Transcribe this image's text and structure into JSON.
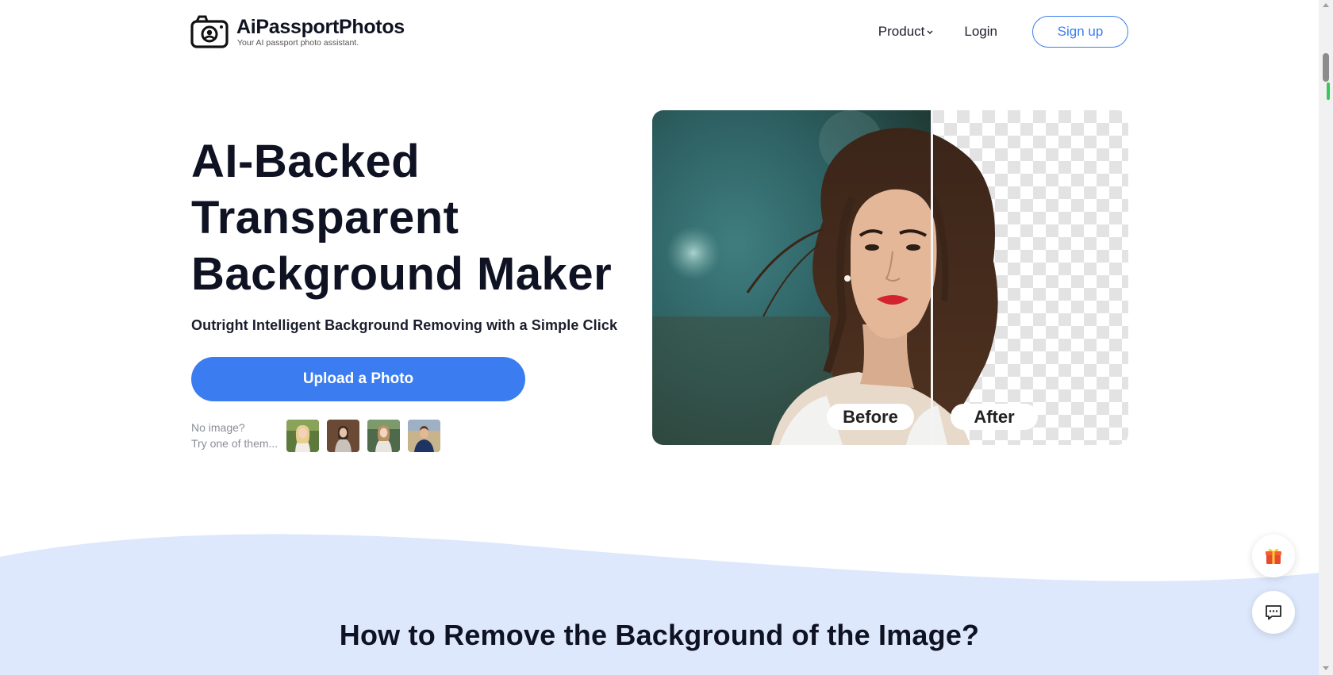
{
  "brand": {
    "name": "AiPassportPhotos",
    "tagline": "Your AI passport photo assistant."
  },
  "nav": {
    "product_label": "Product",
    "login_label": "Login",
    "signup_label": "Sign up"
  },
  "hero": {
    "title_lines": [
      "AI-Backed",
      "Transparent",
      "Background Maker"
    ],
    "subtitle": "Outright Intelligent Background Removing with a Simple Click",
    "upload_label": "Upload a Photo",
    "sample_prompt_line1": "No image?",
    "sample_prompt_line2": "Try one of them..."
  },
  "compare": {
    "before_label": "Before",
    "after_label": "After"
  },
  "how_section": {
    "title": "How to Remove the Background of the Image?"
  },
  "icons": {
    "logo": "camera-icon",
    "product_chevron": "chevron-down-icon",
    "gift": "gift-icon",
    "chat": "chat-icon"
  },
  "colors": {
    "accent": "#3b7df0",
    "wave_bg": "#dde8fd",
    "text_dark": "#0f1222"
  }
}
